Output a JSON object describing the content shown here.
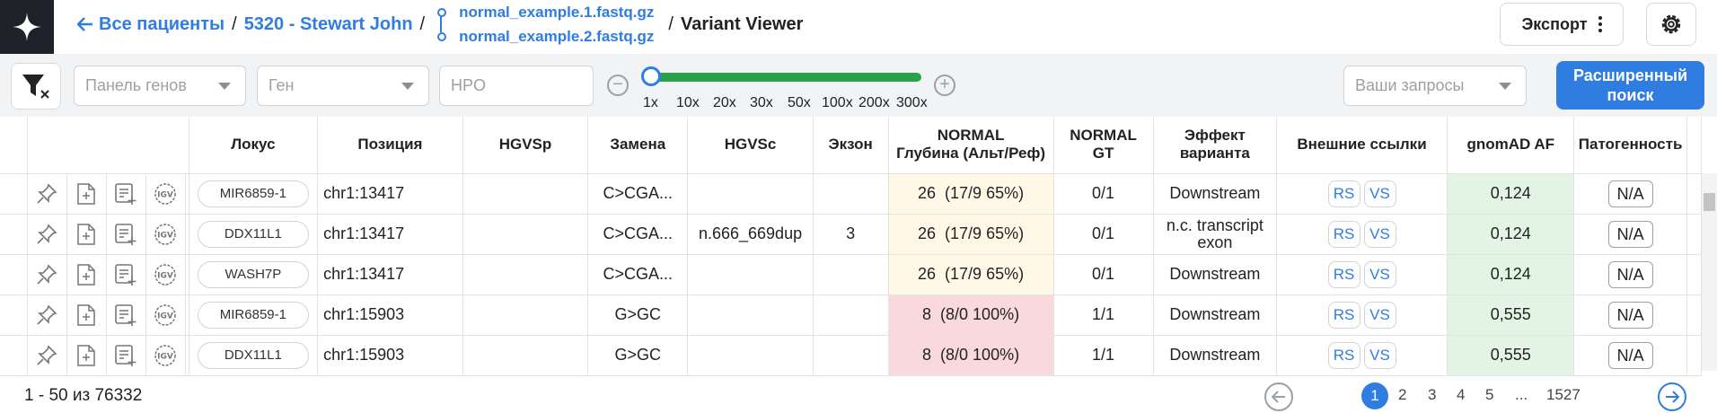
{
  "breadcrumb": {
    "all_patients": "Все пациенты",
    "patient": "5320 - Stewart John",
    "file1": "normal_example.1.fastq.gz",
    "file2": "normal_example.2.fastq.gz",
    "current": "Variant Viewer"
  },
  "header": {
    "export_label": "Экспорт"
  },
  "filters": {
    "gene_panel_placeholder": "Панель генов",
    "gene_placeholder": "Ген",
    "hpo_placeholder": "HPO",
    "queries_placeholder": "Ваши запросы",
    "advanced_search_line1": "Расширенный",
    "advanced_search_line2": "поиск",
    "depth_ticks": [
      "1x",
      "10x",
      "20x",
      "30x",
      "50x",
      "100x",
      "200x",
      "300x"
    ],
    "depth_slider_value": "1x"
  },
  "columns": {
    "locus": "Локус",
    "position": "Позиция",
    "hgvsp": "HGVSp",
    "substitution": "Замена",
    "hgvsc": "HGVSc",
    "exon": "Экзон",
    "depth_line1": "NORMAL",
    "depth_line2": "Глубина (Альт/Реф)",
    "gt_line1": "NORMAL",
    "gt_line2": "GT",
    "effect_line1": "Эффект",
    "effect_line2": "варианта",
    "links": "Внешние ссылки",
    "gnomad": "gnomAD AF",
    "pathogenicity": "Патогенность"
  },
  "rows": [
    {
      "locus": "MIR6859-1",
      "position": "chr1:13417",
      "hgvsp": "",
      "substitution": "C>CGA...",
      "hgvsc": "",
      "exon": "",
      "depth": "26  (17/9 65%)",
      "depth_level": "mid",
      "gt": "0/1",
      "effect": "Downstream",
      "rs": "RS",
      "vs": "VS",
      "gnomad": "0,124",
      "pathogenicity": "N/A"
    },
    {
      "locus": "DDX11L1",
      "position": "chr1:13417",
      "hgvsp": "",
      "substitution": "C>CGA...",
      "hgvsc": "n.666_669dup",
      "exon": "3",
      "depth": "26  (17/9 65%)",
      "depth_level": "mid",
      "gt": "0/1",
      "effect": "n.c. transcript exon",
      "rs": "RS",
      "vs": "VS",
      "gnomad": "0,124",
      "pathogenicity": "N/A"
    },
    {
      "locus": "WASH7P",
      "position": "chr1:13417",
      "hgvsp": "",
      "substitution": "C>CGA...",
      "hgvsc": "",
      "exon": "",
      "depth": "26  (17/9 65%)",
      "depth_level": "mid",
      "gt": "0/1",
      "effect": "Downstream",
      "rs": "RS",
      "vs": "VS",
      "gnomad": "0,124",
      "pathogenicity": "N/A"
    },
    {
      "locus": "MIR6859-1",
      "position": "chr1:15903",
      "hgvsp": "",
      "substitution": "G>GC",
      "hgvsc": "",
      "exon": "",
      "depth": "8  (8/0 100%)",
      "depth_level": "low",
      "gt": "1/1",
      "effect": "Downstream",
      "rs": "RS",
      "vs": "VS",
      "gnomad": "0,555",
      "pathogenicity": "N/A"
    },
    {
      "locus": "DDX11L1",
      "position": "chr1:15903",
      "hgvsp": "",
      "substitution": "G>GC",
      "hgvsc": "",
      "exon": "",
      "depth": "8  (8/0 100%)",
      "depth_level": "low",
      "gt": "1/1",
      "effect": "Downstream",
      "rs": "RS",
      "vs": "VS",
      "gnomad": "0,555",
      "pathogenicity": "N/A"
    }
  ],
  "row_actions": [
    "pin-icon",
    "add-file-icon",
    "add-to-list-icon",
    "igv-icon"
  ],
  "igv_label": "IGV",
  "pagination": {
    "summary": "1 - 50 из 76332",
    "pages": [
      "1",
      "2",
      "3",
      "4",
      "5",
      "...",
      "1527"
    ],
    "current": "1"
  },
  "colors": {
    "accent": "#2f7de1",
    "slider": "#2aa24a",
    "depth_mid": "#fff8e7",
    "depth_low": "#fad9dd",
    "gnomad_bg": "#e3f4e4",
    "logo_bg": "#1f2329"
  }
}
